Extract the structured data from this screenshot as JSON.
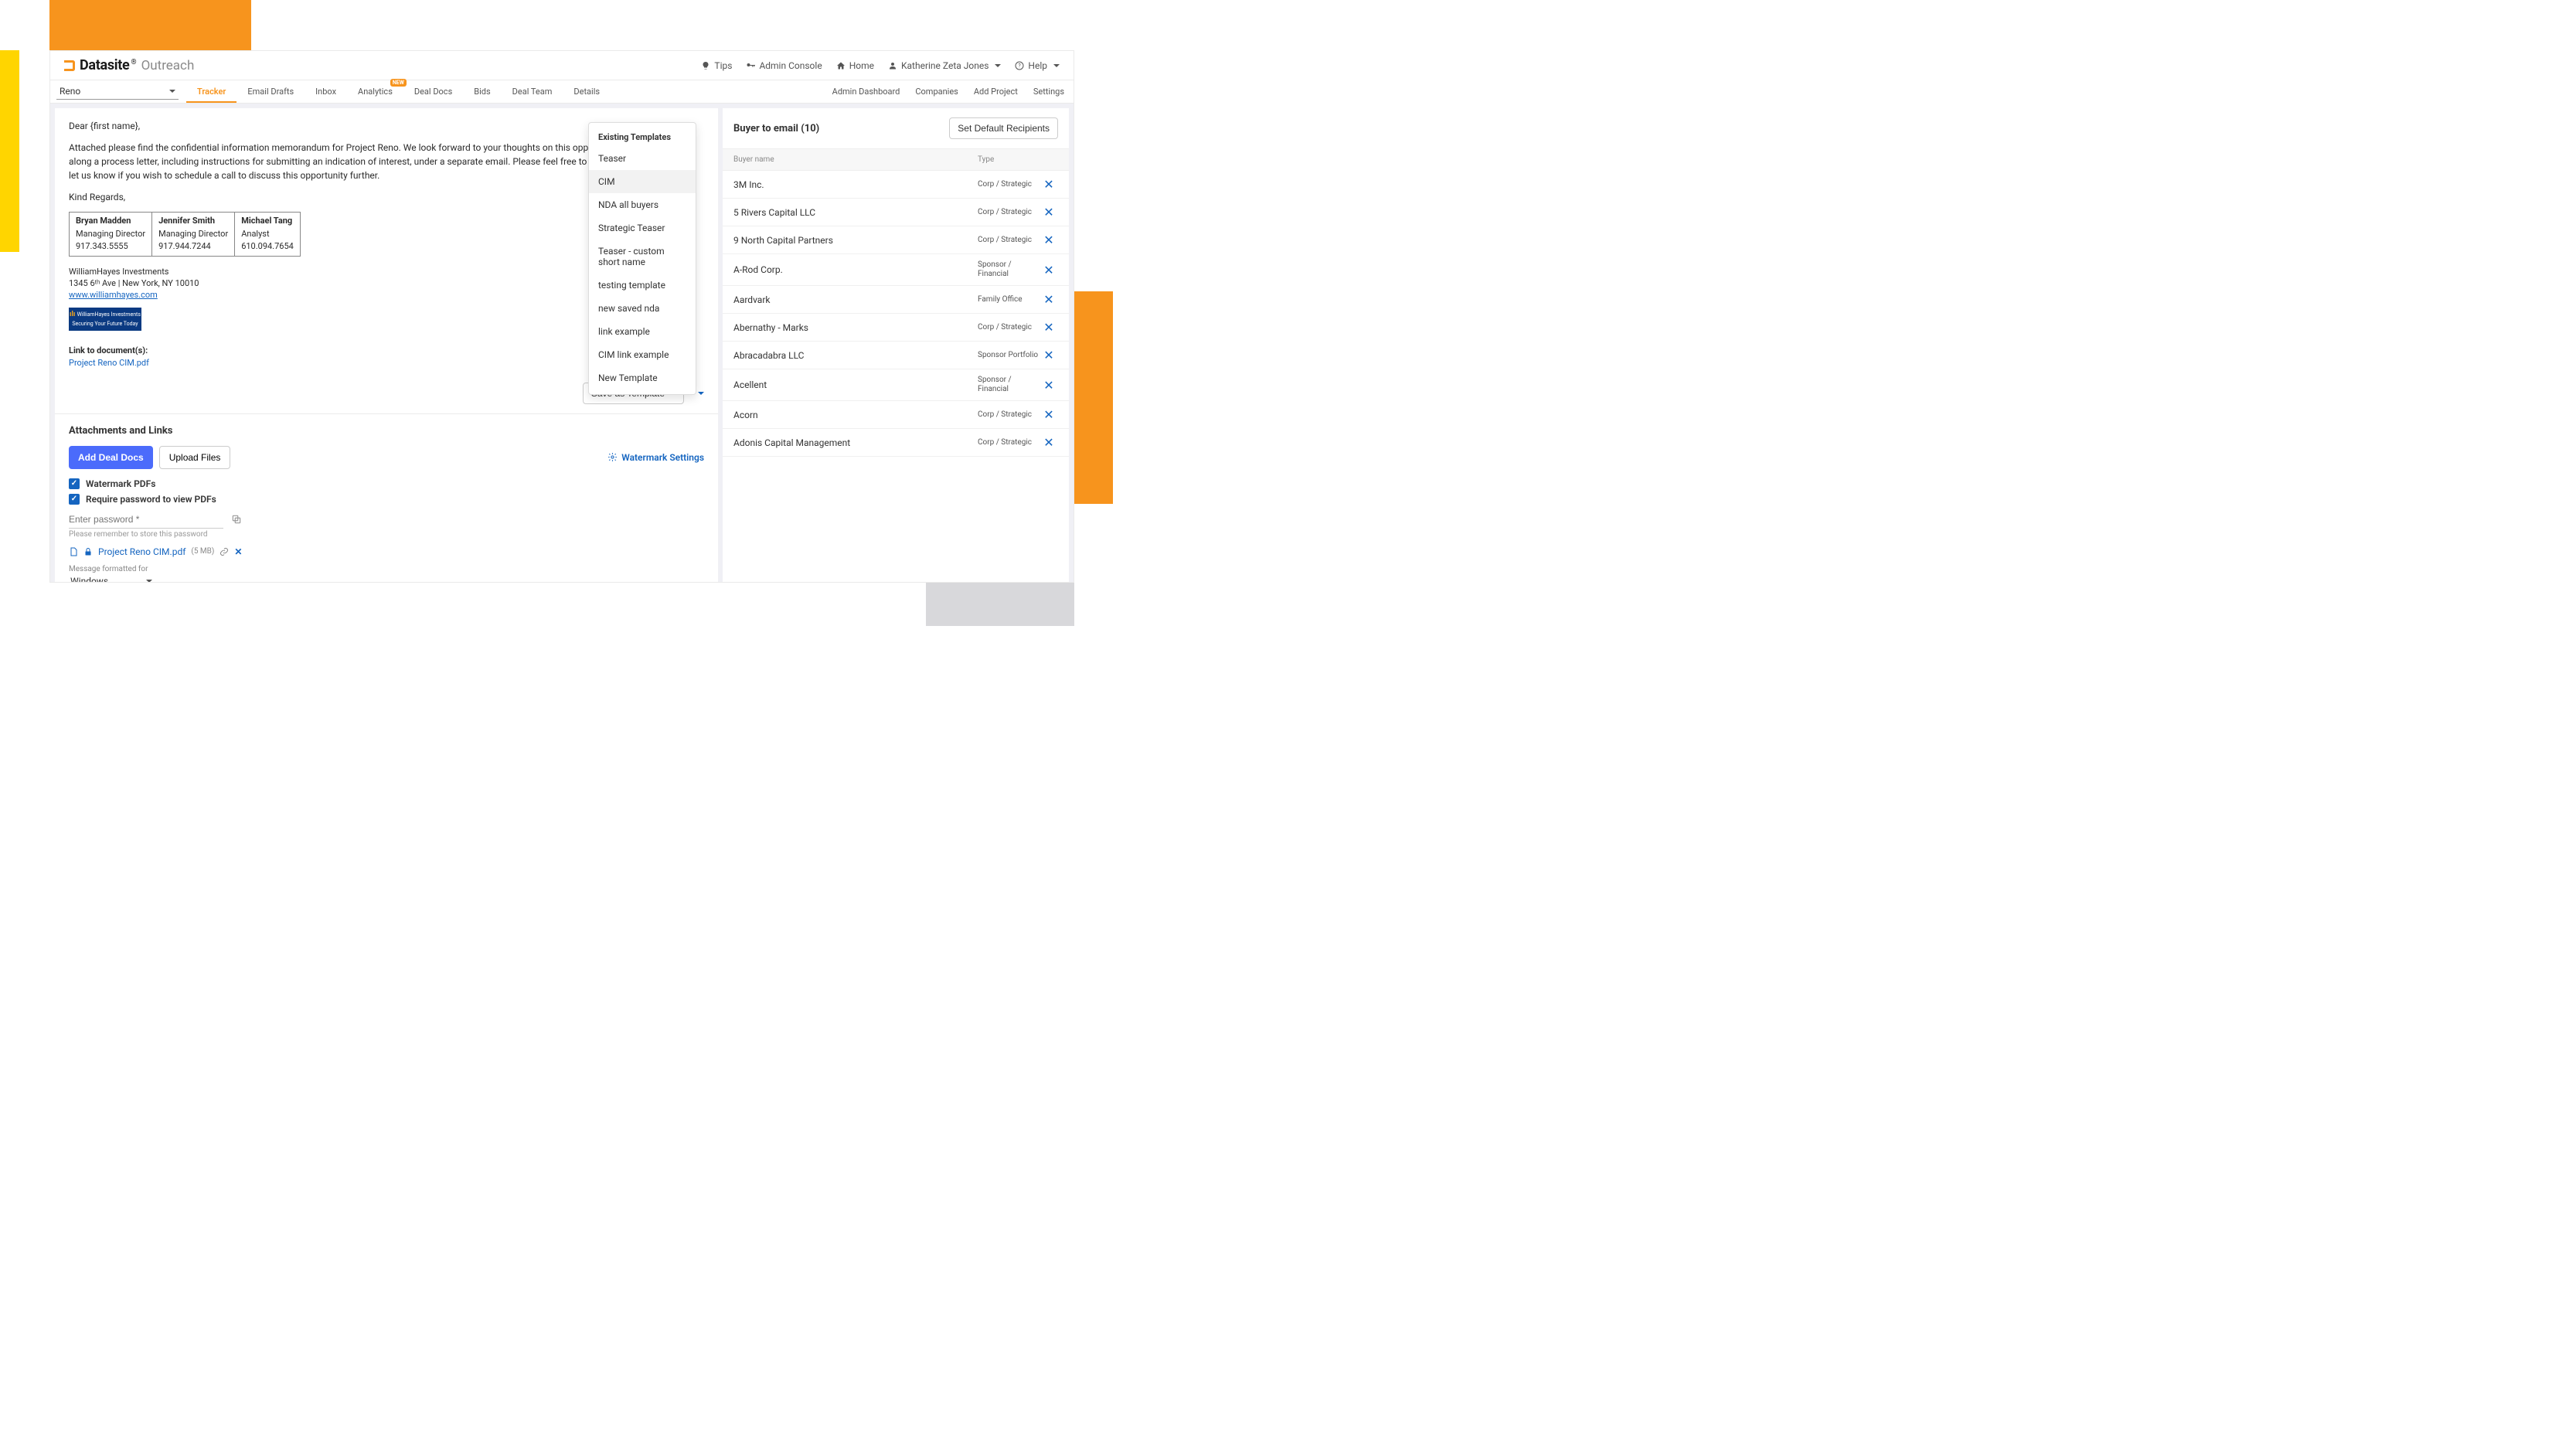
{
  "brand": {
    "name": "Datasite",
    "sub": "Outreach"
  },
  "header": {
    "tips": "Tips",
    "admin_console": "Admin Console",
    "home": "Home",
    "user": "Katherine Zeta Jones",
    "help": "Help"
  },
  "project": {
    "name": "Reno"
  },
  "tabs": {
    "tracker": "Tracker",
    "email_drafts": "Email Drafts",
    "inbox": "Inbox",
    "analytics": "Analytics",
    "analytics_badge": "NEW",
    "deal_docs": "Deal Docs",
    "bids": "Bids",
    "deal_team": "Deal Team",
    "details": "Details"
  },
  "subnav_right": {
    "admin_dash": "Admin Dashboard",
    "companies": "Companies",
    "add_project": "Add Project",
    "settings": "Settings"
  },
  "email": {
    "greeting": "Dear {first name},",
    "body1": "Attached please find the confidential information memorandum for Project Reno. We look forward to your thoughts on this opportunity and will forward along a process letter, including instructions for submitting an indication of interest, under a separate email. Please feel free to call with any questions or let us know if you wish to schedule a call to discuss this opportunity further.",
    "regards": "Kind Regards,",
    "sig": [
      {
        "name": "Bryan Madden",
        "title": "Managing Director",
        "phone": "917.343.5555"
      },
      {
        "name": "Jennifer Smith",
        "title": "Managing Director",
        "phone": "917.944.7244"
      },
      {
        "name": "Michael Tang",
        "title": "Analyst",
        "phone": "610.094.7654"
      }
    ],
    "firm": "WilliamHayes Investments",
    "addr": "1345 6ᵗʰ Ave | New York, NY 10010",
    "url": "www.williamhayes.com",
    "logo_line1": "WilliamHayes Investments",
    "logo_line2": "Securing Your Future Today",
    "link_label": "Link to document(s):",
    "link_doc": "Project Reno CIM.pdf",
    "save_template": "Save as Template"
  },
  "templates": {
    "header": "Existing Templates",
    "items": [
      "Teaser",
      "CIM",
      "NDA all buyers",
      "Strategic Teaser",
      "Teaser - custom short name",
      "testing template",
      "new saved nda",
      "link example",
      "CIM link example",
      "New Template"
    ],
    "selected": "CIM"
  },
  "attach": {
    "title": "Attachments and Links",
    "add_docs": "Add Deal Docs",
    "upload": "Upload Files",
    "watermark_settings": "Watermark Settings",
    "watermark_pdfs": "Watermark PDFs",
    "require_pwd": "Require password to view PDFs",
    "pwd_placeholder": "Enter password *",
    "pwd_hint": "Please remember to store this password",
    "file_name": "Project Reno CIM.pdf",
    "file_size": "(5 MB)",
    "msg_fmt_label": "Message formatted for",
    "msg_fmt_value": "Windows"
  },
  "side": {
    "title": "Buyer to email (10)",
    "set_default": "Set Default Recipients",
    "col_name": "Buyer name",
    "col_type": "Type",
    "buyers": [
      {
        "name": "3M Inc.",
        "type": "Corp / Strategic"
      },
      {
        "name": "5 Rivers Capital LLC",
        "type": "Corp / Strategic"
      },
      {
        "name": "9 North Capital Partners",
        "type": "Corp / Strategic"
      },
      {
        "name": "A-Rod Corp.",
        "type": "Sponsor / Financial"
      },
      {
        "name": "Aardvark",
        "type": "Family Office"
      },
      {
        "name": "Abernathy - Marks",
        "type": "Corp / Strategic"
      },
      {
        "name": "Abracadabra LLC",
        "type": "Sponsor Portfolio"
      },
      {
        "name": "Acellent",
        "type": "Sponsor / Financial"
      },
      {
        "name": "Acorn",
        "type": "Corp / Strategic"
      },
      {
        "name": "Adonis Capital Management",
        "type": "Corp / Strategic"
      }
    ]
  }
}
